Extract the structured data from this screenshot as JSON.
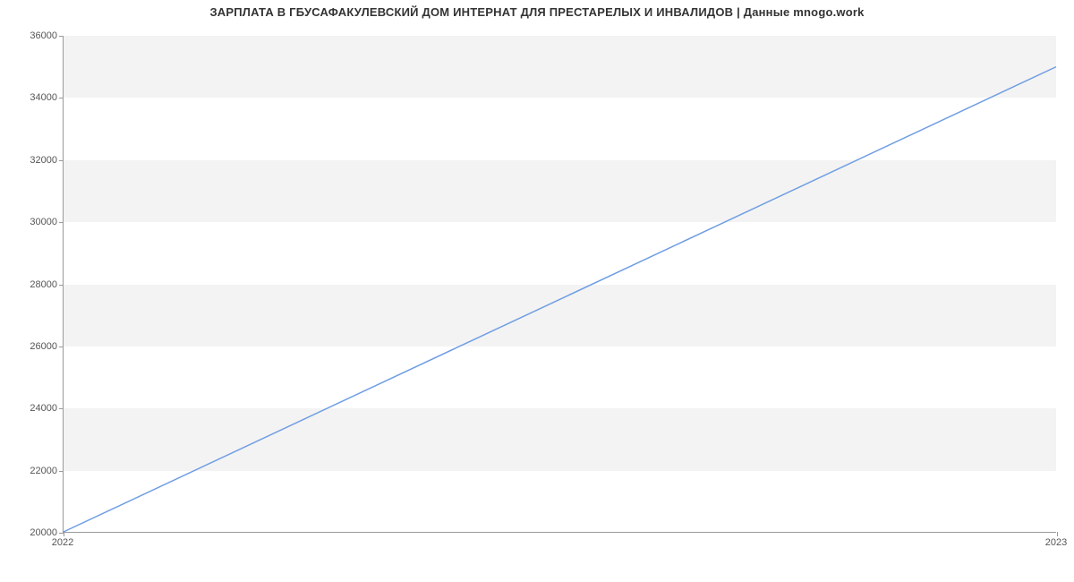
{
  "chart_data": {
    "type": "line",
    "title": "ЗАРПЛАТА В ГБУСАФАКУЛЕВСКИЙ ДОМ ИНТЕРНАТ ДЛЯ ПРЕСТАРЕЛЫХ И ИНВАЛИДОВ | Данные mnogo.work",
    "xlabel": "",
    "ylabel": "",
    "x_ticks": [
      "2022",
      "2023"
    ],
    "y_ticks": [
      20000,
      22000,
      24000,
      26000,
      28000,
      30000,
      32000,
      34000,
      36000
    ],
    "ylim": [
      20000,
      36000
    ],
    "series": [
      {
        "name": "salary",
        "x": [
          "2022",
          "2023"
        ],
        "values": [
          20000,
          35000
        ]
      }
    ],
    "line_color": "#6f9de3",
    "band_color": "#f3f3f3"
  }
}
